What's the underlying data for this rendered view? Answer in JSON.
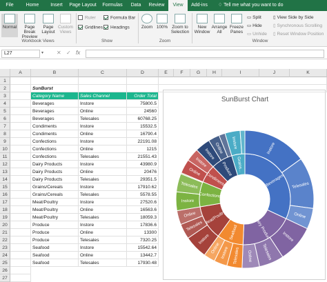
{
  "tabs": [
    "File",
    "Home",
    "Insert",
    "Page Layout",
    "Formulas",
    "Data",
    "Review",
    "View",
    "Add-ins"
  ],
  "active_tab": "View",
  "tell_me": "Tell me what you want to do",
  "ribbon": {
    "workbook_views": {
      "label": "Workbook Views",
      "normal": "Normal",
      "page_break": "Page Break Preview",
      "page_layout": "Page Layout",
      "custom_views": "Custom Views"
    },
    "show": {
      "label": "Show",
      "ruler": "Ruler",
      "gridlines": "Gridlines",
      "formula_bar": "Formula Bar",
      "headings": "Headings"
    },
    "zoom": {
      "label": "Zoom",
      "zoom": "Zoom",
      "hundred": "100%",
      "zoom_sel": "Zoom to Selection"
    },
    "window": {
      "label": "Window",
      "new_window": "New Window",
      "arrange_all": "Arrange All",
      "freeze": "Freeze Panes",
      "split": "Split",
      "hide": "Hide",
      "unhide": "Unhide",
      "side_by_side": "View Side by Side",
      "sync": "Synchronous Scrolling",
      "reset": "Reset Window Position"
    }
  },
  "name_box": "L27",
  "fx": "fx",
  "columns": [
    "A",
    "B",
    "C",
    "D",
    "E",
    "F",
    "G",
    "H",
    "I",
    "J",
    "K"
  ],
  "rows": [
    "1",
    "2",
    "3",
    "4",
    "5",
    "6",
    "7",
    "8",
    "9",
    "10",
    "11",
    "12",
    "13",
    "14",
    "15",
    "16",
    "17",
    "18",
    "19",
    "20",
    "21",
    "22",
    "23",
    "24",
    "25",
    "26",
    "27"
  ],
  "sheet_title": "SunBurst",
  "table_headers": [
    "Category Name",
    "Sales Channel",
    "Order Total"
  ],
  "table_rows": [
    [
      "Beverages",
      "Instore",
      "75800.5"
    ],
    [
      "Beverages",
      "Online",
      "24560"
    ],
    [
      "Beverages",
      "Telesales",
      "60768.25"
    ],
    [
      "Condiments",
      "Instore",
      "15532.5"
    ],
    [
      "Condiments",
      "Online",
      "16790.4"
    ],
    [
      "Confections",
      "Instore",
      "22191.08"
    ],
    [
      "Confections",
      "Online",
      "1215"
    ],
    [
      "Confections",
      "Telesales",
      "21551.43"
    ],
    [
      "Dairy Products",
      "Instore",
      "43980.9"
    ],
    [
      "Dairy Products",
      "Online",
      "20476"
    ],
    [
      "Dairy Products",
      "Telesales",
      "29351.5"
    ],
    [
      "Grains/Cereals",
      "Instore",
      "17910.62"
    ],
    [
      "Grains/Cereals",
      "Telesales",
      "5578.55"
    ],
    [
      "Meat/Poultry",
      "Instore",
      "27520.6"
    ],
    [
      "Meat/Poultry",
      "Online",
      "16563.6"
    ],
    [
      "Meat/Poultry",
      "Telesales",
      "18059.3"
    ],
    [
      "Produce",
      "Instore",
      "17836.6"
    ],
    [
      "Produce",
      "Online",
      "13300"
    ],
    [
      "Produce",
      "Telesales",
      "7320.25"
    ],
    [
      "Seafood",
      "Instore",
      "15542.64"
    ],
    [
      "Seafood",
      "Online",
      "13442.7"
    ],
    [
      "Seafood",
      "Telesales",
      "17930.48"
    ]
  ],
  "chart_data": {
    "type": "sunburst",
    "title": "SunBurst Chart",
    "colors": {
      "Beverages": "#4472c4",
      "Dairy Products": "#8064a2",
      "Seafood": "#f28a30",
      "Meat/Poultry": "#a5423b",
      "Confections": "#7cb342",
      "Condiments": "#c0504d",
      "Produce": "#2e4a7a",
      "Grains/Cereals": "#4bacc6"
    },
    "inner_labels": {
      "Beverages": "Beverages",
      "Dairy Products": "Dairy Products",
      "Seafood": "Seafood",
      "Meat/Poultry": "Meat/Poultry",
      "Confections": "Confections",
      "Condiments": "Condiments",
      "Produce": "Produce",
      "Grains/Cereals": "Grains..."
    },
    "categories": [
      {
        "name": "Beverages",
        "children": [
          {
            "name": "Instore",
            "value": 75800.5
          },
          {
            "name": "Telesales",
            "value": 60768.25
          },
          {
            "name": "Online",
            "value": 24560
          }
        ]
      },
      {
        "name": "Dairy Products",
        "children": [
          {
            "name": "Instore",
            "value": 43980.9
          },
          {
            "name": "Telesales",
            "value": 29351.5
          },
          {
            "name": "Online",
            "value": 20476
          }
        ]
      },
      {
        "name": "Seafood",
        "children": [
          {
            "name": "Telesales",
            "value": 17930.48
          },
          {
            "name": "Instore",
            "value": 15542.64
          },
          {
            "name": "Online",
            "value": 13442.7
          }
        ]
      },
      {
        "name": "Meat/Poultry",
        "children": [
          {
            "name": "Instore",
            "value": 27520.6
          },
          {
            "name": "Telesales",
            "value": 18059.3
          },
          {
            "name": "Online",
            "value": 16563.6
          }
        ]
      },
      {
        "name": "Confections",
        "children": [
          {
            "name": "Instore",
            "value": 22191.08
          },
          {
            "name": "Telesales",
            "value": 21551.43
          },
          {
            "name": "Online",
            "value": 1215
          }
        ]
      },
      {
        "name": "Condiments",
        "children": [
          {
            "name": "Online",
            "value": 16790.4
          },
          {
            "name": "Instore",
            "value": 15532.5
          }
        ]
      },
      {
        "name": "Produce",
        "children": [
          {
            "name": "Instore",
            "value": 17836.6
          },
          {
            "name": "Online",
            "value": 13300
          },
          {
            "name": "Telesales",
            "value": 7320.25
          }
        ]
      },
      {
        "name": "Grains/Cereals",
        "children": [
          {
            "name": "Instore",
            "value": 17910.62
          },
          {
            "name": "Telesales",
            "value": 5578.55
          }
        ]
      }
    ]
  }
}
